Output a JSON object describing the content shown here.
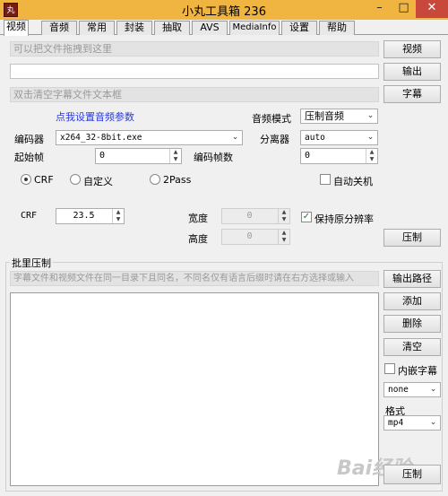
{
  "window": {
    "title": "小丸工具箱 236",
    "icon_text": "丸"
  },
  "tabs": [
    "视频",
    "音频",
    "常用",
    "封装",
    "抽取",
    "AVS",
    "MediaInfo",
    "设置",
    "帮助"
  ],
  "inputs": {
    "video_hint": "可以把文件拖拽到这里",
    "output_value": "",
    "subtitle_hint": "双击清空字幕文件文本框"
  },
  "buttons": {
    "video": "视频",
    "output": "输出",
    "subtitle": "字幕",
    "compress": "压制",
    "output_path": "输出路径",
    "add": "添加",
    "delete": "删除",
    "clear": "清空",
    "batch_compress": "压制"
  },
  "audio": {
    "settings_link": "点我设置音频参数",
    "mode_label": "音频模式",
    "mode_value": "压制音频"
  },
  "encoder": {
    "label": "编码器",
    "value": "x264_32-8bit.exe"
  },
  "demuxer": {
    "label": "分离器",
    "value": "auto"
  },
  "start_frame": {
    "label": "起始帧",
    "value": "0"
  },
  "encode_frames": {
    "label": "编码帧数",
    "value": "0"
  },
  "rate_modes": {
    "crf": "CRF",
    "custom": "自定义",
    "two_pass": "2Pass",
    "selected": "CRF"
  },
  "auto_shutdown": {
    "label": "自动关机",
    "checked": false
  },
  "crf": {
    "label": "CRF",
    "value": "23.5"
  },
  "width": {
    "label": "宽度",
    "value": "0"
  },
  "height": {
    "label": "高度",
    "value": "0"
  },
  "keep_resolution": {
    "label": "保持原分辨率",
    "checked": true
  },
  "batch": {
    "title": "批里压制",
    "hint": "字幕文件和视频文件在同一目录下且同名，不同名仅有语言后缀时请在右方选择或输入",
    "embed_subtitle": {
      "label": "内嵌字幕",
      "checked": false
    },
    "subtitle_lang_value": "none",
    "format_label": "格式",
    "format_value": "mp4"
  },
  "watermark": "Bai经验",
  "icons": {
    "dropdown": "chevron-down-icon",
    "spin_up": "triangle-up-icon",
    "spin_down": "triangle-down-icon"
  }
}
